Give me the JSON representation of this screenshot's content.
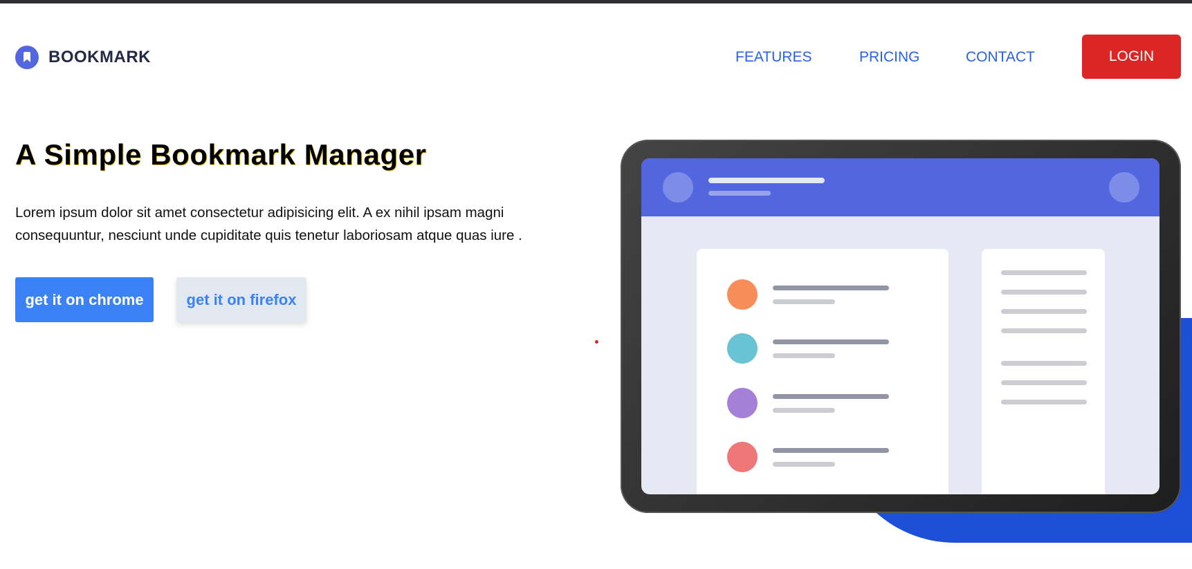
{
  "header": {
    "logo_text": "BOOKMARK",
    "nav": {
      "features": "FEATURES",
      "pricing": "PRICING",
      "contact": "CONTACT"
    },
    "login_label": "LOGIN"
  },
  "hero": {
    "title": "A Simple Bookmark Manager",
    "description": "Lorem ipsum dolor sit amet consectetur adipisicing elit. A ex nihil ipsam magni consequuntur, nesciunt unde cupiditate quis tenetur laboriosam atque quas iure .",
    "chrome_button": "get it on chrome",
    "firefox_button": "get it on firefox"
  },
  "colors": {
    "brand": "#5267df",
    "nav_link": "#2563eb",
    "login": "#dc2626",
    "primary_button": "#3b82f6",
    "secondary_button": "#e2e8f0",
    "accent_shape": "#1d4fd8"
  },
  "icons": {
    "logo": "bookmark-icon"
  },
  "illustration": {
    "list_item_colors": [
      "#f78d59",
      "#68c4d4",
      "#a57fd8",
      "#ef7777"
    ]
  }
}
